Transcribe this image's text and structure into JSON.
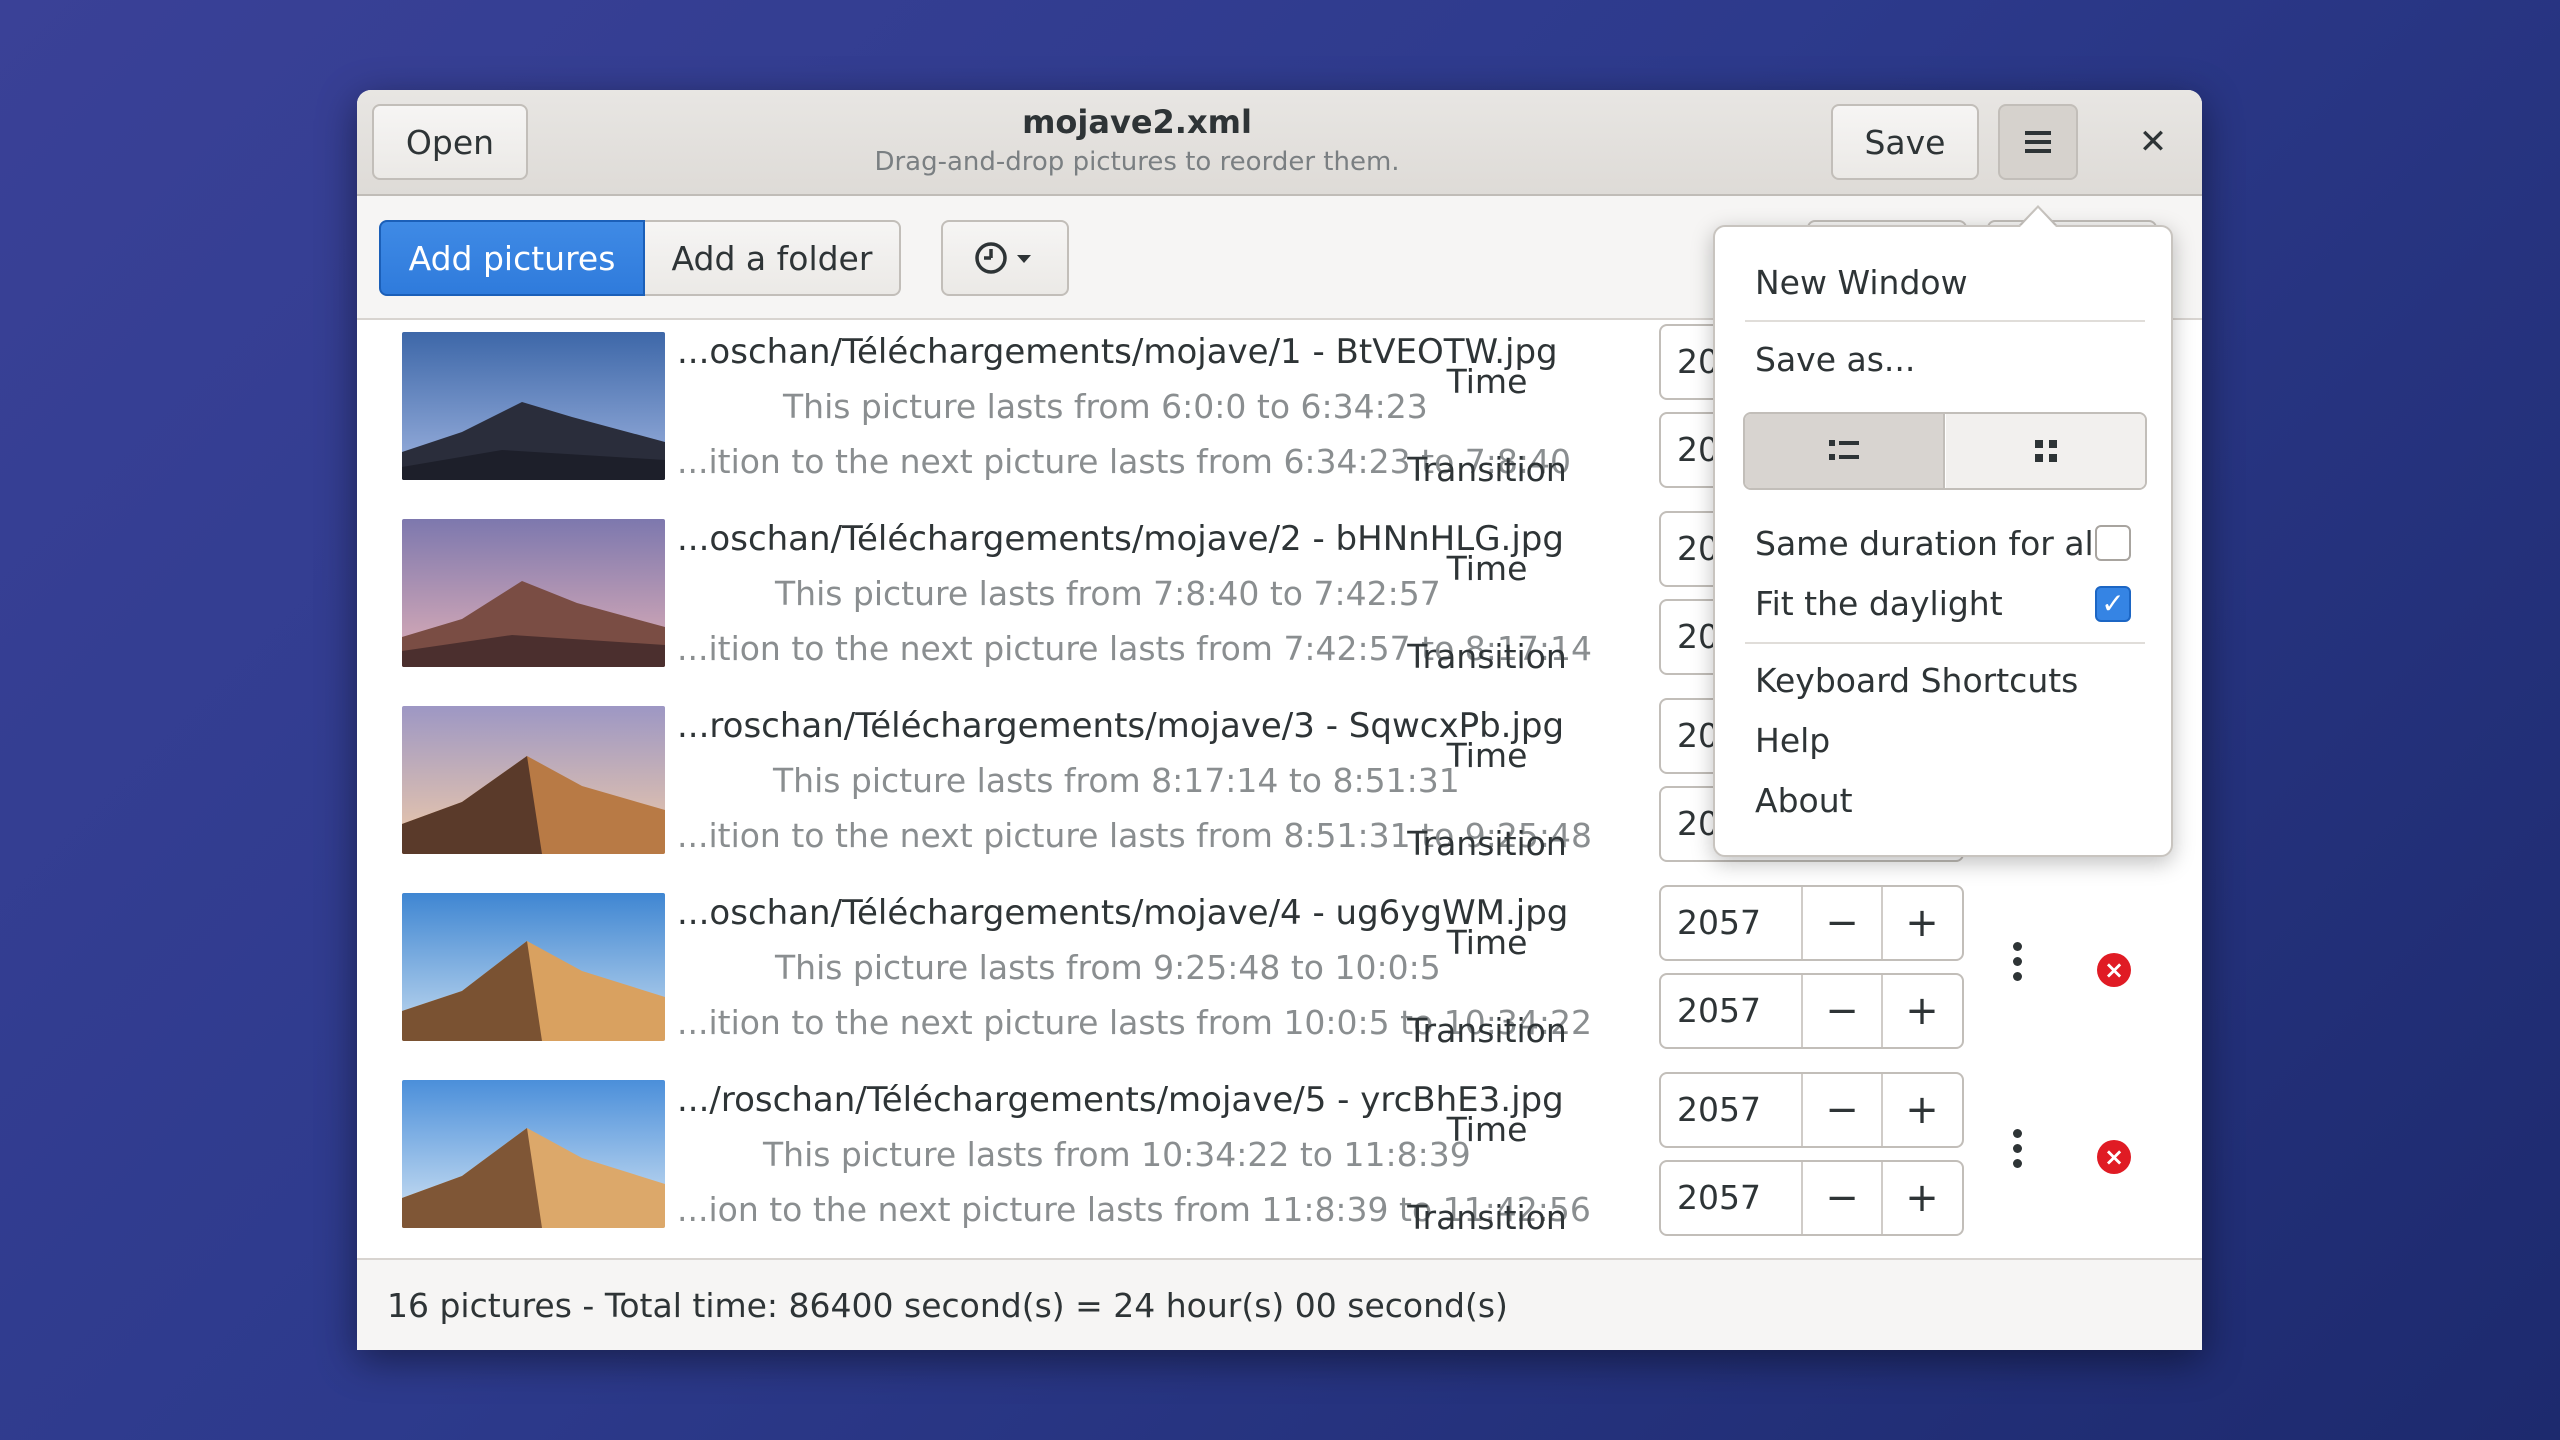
{
  "window": {
    "title": "mojave2.xml",
    "subtitle": "Drag-and-drop pictures to reorder them.",
    "open_label": "Open",
    "save_label": "Save",
    "menu_icon": "hamburger-menu-icon",
    "close_glyph": "✕"
  },
  "toolbar": {
    "add_pictures_label": "Add pictures",
    "add_folder_label": "Add a folder",
    "clock_menu_icon": "clock-icon"
  },
  "rows": [
    {
      "filename": "...oschan/Téléchargements/mojave/1 - BtVEOTW.jpg",
      "lasts": "This picture lasts from 6:0:0 to 6:34:23",
      "transition": "...ition to the next picture lasts from 6:34:23 to 7:8:40",
      "time_label": "Time",
      "transition_label": "Transition",
      "time_value": "20",
      "transition_value": "20",
      "thumb_colors": [
        "#5a7db8",
        "#98aede",
        "#2b2e3c"
      ]
    },
    {
      "filename": "...oschan/Téléchargements/mojave/2 - bHNnHLG.jpg",
      "lasts": "This picture lasts from 7:8:40 to 7:42:57",
      "transition": "...ition to the next picture lasts from 7:42:57 to 8:17:14",
      "time_label": "Time",
      "transition_label": "Transition",
      "time_value": "20",
      "transition_value": "20",
      "thumb_colors": [
        "#8c82b3",
        "#d6a7b3",
        "#6b4a4c"
      ]
    },
    {
      "filename": "...roschan/Téléchargements/mojave/3 - SqwcxPb.jpg",
      "lasts": "This picture lasts from 8:17:14 to 8:51:31",
      "transition": "...ition to the next picture lasts from 8:51:31 to 9:25:48",
      "time_label": "Time",
      "transition_label": "Transition",
      "time_value": "20",
      "transition_value": "20",
      "thumb_colors": [
        "#a9a2c8",
        "#e8c5a6",
        "#b27a4f"
      ]
    },
    {
      "filename": "...oschan/Téléchargements/mojave/4 - ug6ygWM.jpg",
      "lasts": "This picture lasts from 9:25:48 to 10:0:5",
      "transition": "...ition to the next picture lasts from 10:0:5 to 10:34:22",
      "time_label": "Time",
      "transition_label": "Transition",
      "time_value": "2057",
      "transition_value": "2057",
      "thumb_colors": [
        "#4c8fd6",
        "#b7d3ec",
        "#d8a565"
      ]
    },
    {
      "filename": ".../roschan/Téléchargements/mojave/5 - yrcBhE3.jpg",
      "lasts": "This picture lasts from 10:34:22 to 11:8:39",
      "transition": "...ion to the next picture lasts from 11:8:39 to 11:42:56",
      "time_label": "Time",
      "transition_label": "Transition",
      "time_value": "2057",
      "transition_value": "2057",
      "thumb_colors": [
        "#4e93dc",
        "#c8def2",
        "#dcab6b"
      ]
    }
  ],
  "spin": {
    "minus": "−",
    "plus": "+"
  },
  "status": {
    "text": "16 pictures - Total time: 86400 second(s) = 24 hour(s) 00 second(s)"
  },
  "menu": {
    "new_window": "New Window",
    "save_as": "Save as...",
    "list_view_icon": "list-view-icon",
    "grid_view_icon": "grid-view-icon",
    "same_duration": "Same duration for all",
    "same_duration_checked": false,
    "fit_daylight": "Fit the daylight",
    "fit_daylight_checked": true,
    "keyboard_shortcuts": "Keyboard Shortcuts",
    "help": "Help",
    "about": "About"
  },
  "colors": {
    "accent": "#3584e4",
    "remove": "#e01b24",
    "background": "#2d3a8c"
  }
}
